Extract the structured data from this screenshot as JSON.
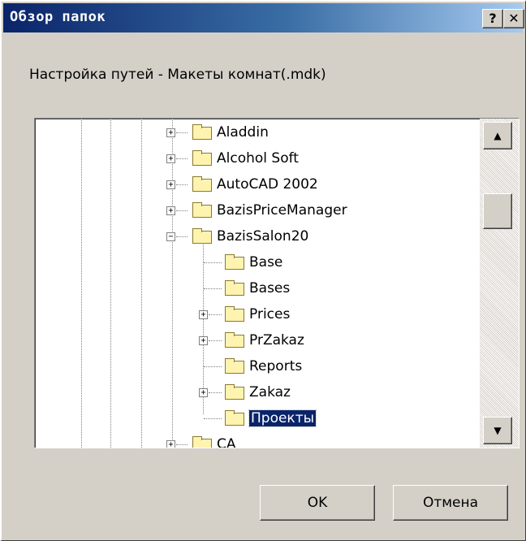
{
  "window": {
    "title": "Обзор папок",
    "help_label": "?",
    "close_label": "✕"
  },
  "caption": "Настройка путей - Макеты комнат(.mdk)",
  "tree": {
    "nodes": [
      {
        "label": "Aladdin",
        "expander": "+"
      },
      {
        "label": "Alcohol Soft",
        "expander": "+"
      },
      {
        "label": "AutoCAD 2002",
        "expander": "+"
      },
      {
        "label": "BazisPriceManager",
        "expander": "+"
      },
      {
        "label": "BazisSalon20",
        "expander": "−"
      },
      {
        "label": "Base",
        "expander": ""
      },
      {
        "label": "Bases",
        "expander": ""
      },
      {
        "label": "Prices",
        "expander": "+"
      },
      {
        "label": "PrZakaz",
        "expander": "+"
      },
      {
        "label": "Reports",
        "expander": ""
      },
      {
        "label": "Zakaz",
        "expander": "+"
      },
      {
        "label": "Проекты",
        "expander": "",
        "selected": true
      },
      {
        "label": "CA",
        "expander": "+"
      }
    ],
    "scroll_position": 0.2
  },
  "buttons": {
    "ok": "OK",
    "cancel": "Отмена"
  }
}
